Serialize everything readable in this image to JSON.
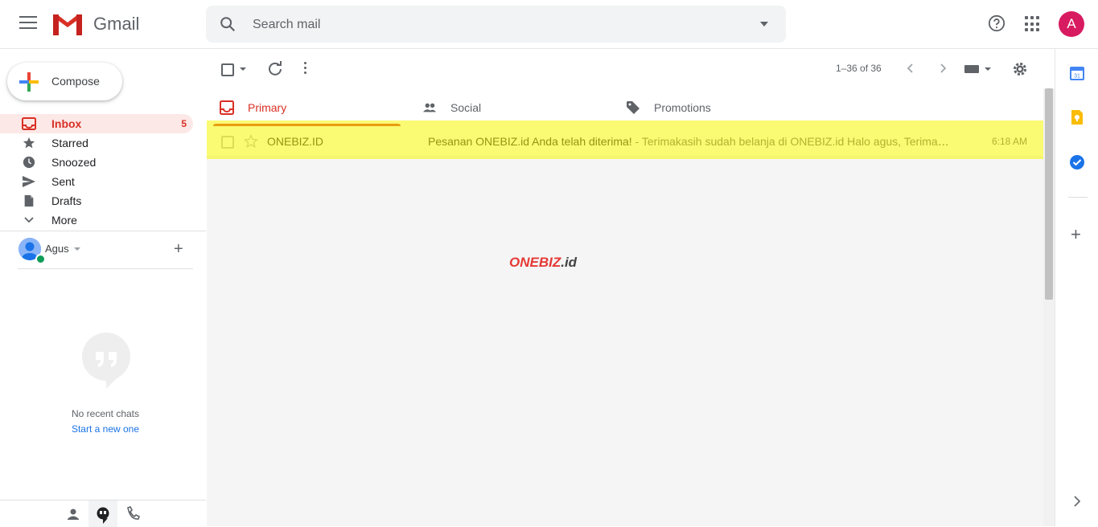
{
  "header": {
    "brand": "Gmail",
    "search_placeholder": "Search mail",
    "avatar_letter": "A"
  },
  "compose": {
    "label": "Compose"
  },
  "sidebar": {
    "items": [
      {
        "label": "Inbox",
        "count": "5",
        "icon": "inbox-icon",
        "active": true
      },
      {
        "label": "Starred",
        "icon": "star-icon"
      },
      {
        "label": "Snoozed",
        "icon": "clock-icon"
      },
      {
        "label": "Sent",
        "icon": "send-icon"
      },
      {
        "label": "Drafts",
        "icon": "draft-icon"
      },
      {
        "label": "More",
        "icon": "chevron-down-icon"
      }
    ]
  },
  "hangouts": {
    "user_name": "Agus",
    "no_chats": "No recent chats",
    "start_new": "Start a new one"
  },
  "toolbar": {
    "range": "1–36 of 36"
  },
  "tabs": [
    {
      "label": "Primary",
      "icon": "inbox-icon",
      "active": true
    },
    {
      "label": "Social",
      "icon": "people-icon"
    },
    {
      "label": "Promotions",
      "icon": "tag-icon"
    }
  ],
  "emails": [
    {
      "sender": "ONEBIZ.ID",
      "subject": "Pesanan ONEBIZ.id Anda telah diterima!",
      "snippet": " - Terimakasih sudah belanja di ONEBIZ.id Halo agus, Terima kasih telah berbelanja",
      "time": "6:18 AM"
    }
  ],
  "watermark": {
    "brand": "ONEBIZ",
    "suffix": ".id"
  },
  "colors": {
    "accent": "#d93025",
    "highlight": "#f5f500",
    "avatar": "#d81b60",
    "link": "#1a73e8"
  }
}
